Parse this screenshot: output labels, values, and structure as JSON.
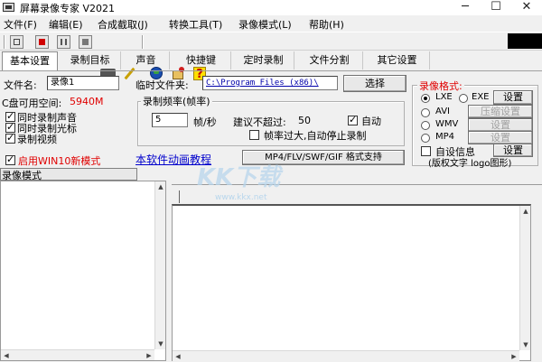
{
  "window": {
    "title": "屏幕录像专家 V2021",
    "minimize_glyph": "─",
    "maximize_glyph": "☐",
    "close_glyph": "✕",
    "icon": "app-icon"
  },
  "menu": [
    "文件(F)",
    "编辑(E)",
    "合成截取(J)",
    "转换工具(T)",
    "录像模式(L)",
    "帮助(H)"
  ],
  "toolbar": {
    "icons": [
      "square-icon",
      "record-icon",
      "pause-icon",
      "stop-icon",
      "camera-icon",
      "pen-icon",
      "globe-icon",
      "paint-icon",
      "help-icon"
    ],
    "help_glyph": "?"
  },
  "tabs": [
    "基本设置",
    "录制目标",
    "声音",
    "快捷键",
    "定时录制",
    "文件分割",
    "其它设置"
  ],
  "active_tab": "基本设置",
  "basic": {
    "filename_label": "文件名:",
    "filename_value": "录像1",
    "tempdir_label": "临时文件夹:",
    "tempdir_value": "C:\\Program Files (x86)\\",
    "choose_button": "选择",
    "disk_label": "C盘可用空间:",
    "disk_value": "5940M",
    "options": [
      {
        "label": "同时录制声音",
        "checked": true
      },
      {
        "label": "同时录制光标",
        "checked": true
      },
      {
        "label": "录制视频",
        "checked": true
      }
    ],
    "win10_label": "启用WIN10新模式",
    "win10_checked": true,
    "framerate": {
      "legend": "录制频率(帧率)",
      "value": "5",
      "unit": "帧/秒",
      "suggest_label": "建议不超过:",
      "suggest_value": "50",
      "auto_label": "自动",
      "auto_checked": true,
      "overflow_label": "帧率过大,自动停止录制",
      "overflow_checked": false
    },
    "tutorial_link": "本软件动画教程",
    "format_support_button": "MP4/FLV/SWF/GIF  格式支持",
    "video_format": {
      "legend": "录像格式:",
      "formats": [
        {
          "label": "LXE",
          "selected": true,
          "button": "设置",
          "button_enabled": true
        },
        {
          "label": "AVI",
          "selected": false,
          "button": "压缩设置",
          "button_enabled": false
        },
        {
          "label": "WMV",
          "selected": false,
          "button": "设置",
          "button_enabled": false
        },
        {
          "label": "MP4",
          "selected": false,
          "button": "设置",
          "button_enabled": false
        }
      ],
      "exe_label": "EXE",
      "exe_selected": false,
      "custom_info_label": "自设信息",
      "custom_info_checked": false,
      "custom_info_button": "设置",
      "copyright_label": "(版权文字 logo图形)"
    }
  },
  "status_strip_label": "录像模式",
  "watermark": {
    "text": "KK下载",
    "url": "www.kkx.net"
  },
  "colors": {
    "red_text": "#e00000",
    "link_blue": "#0000cc",
    "watermark": "#b8d6ec"
  }
}
